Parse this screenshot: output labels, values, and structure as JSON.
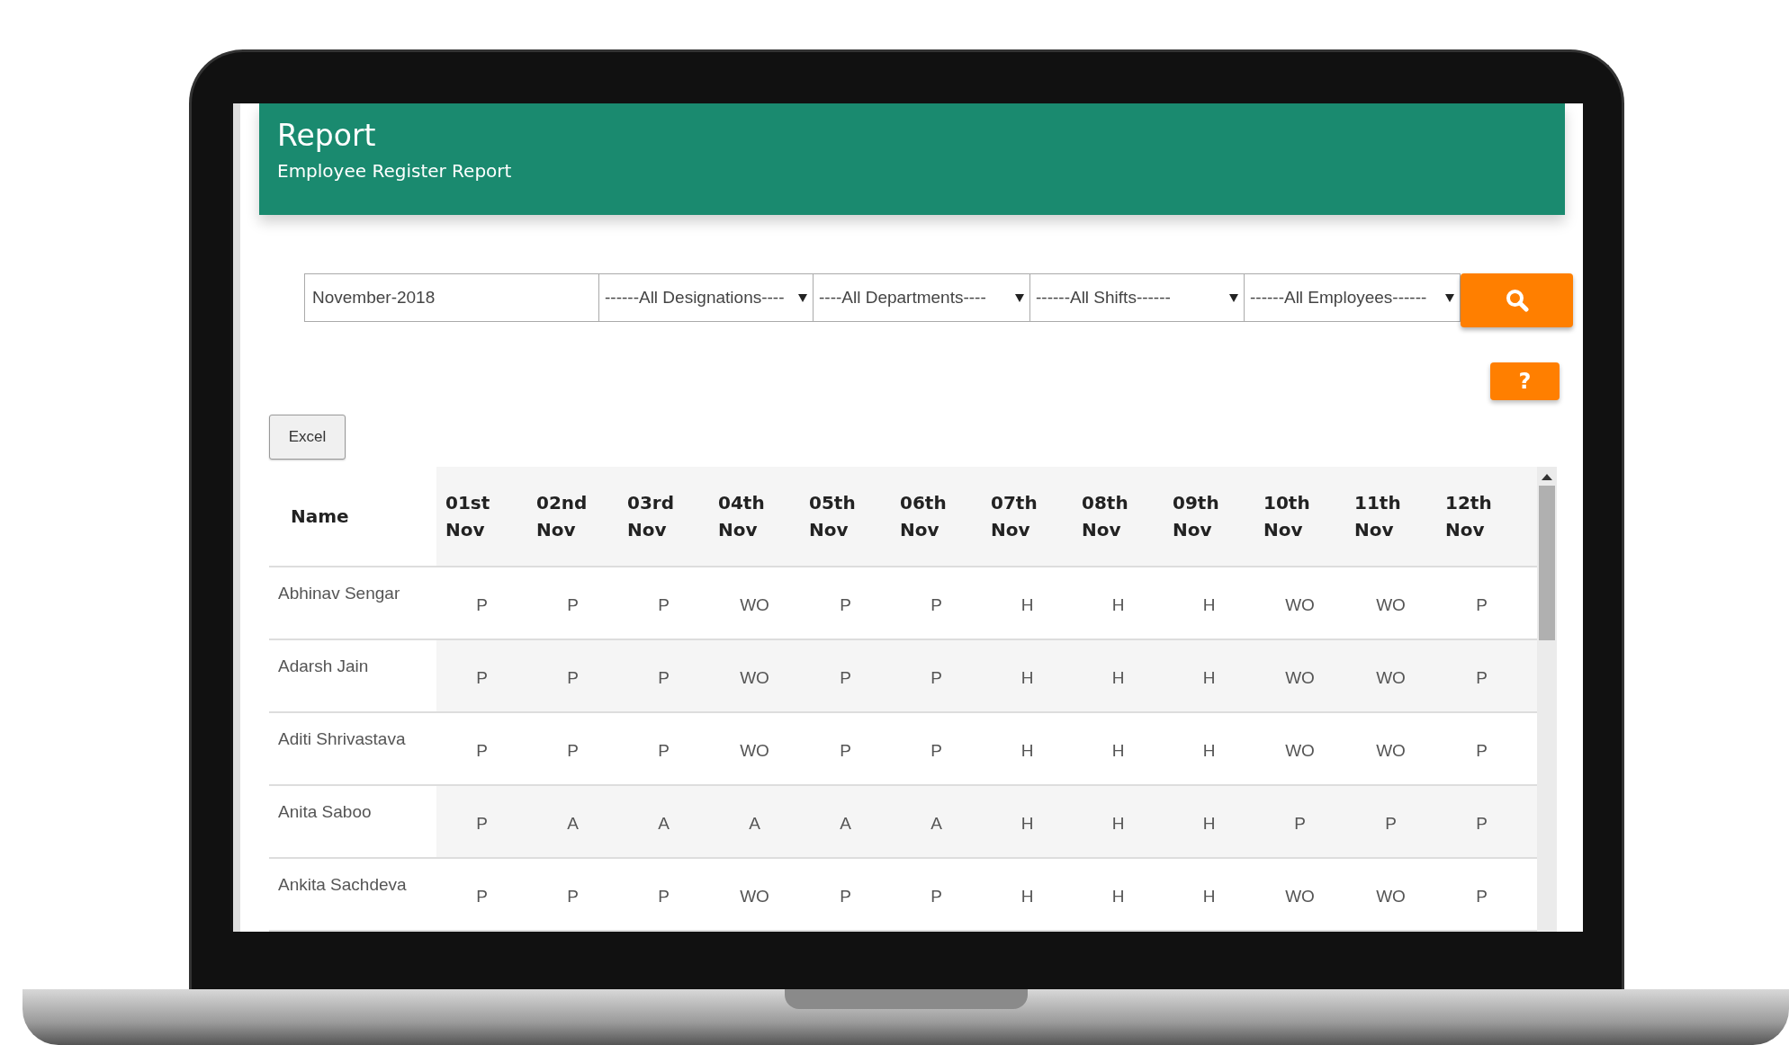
{
  "header": {
    "title": "Report",
    "subtitle": "Employee Register Report"
  },
  "filters": {
    "month": "November-2018",
    "selects": [
      "------All Designations----",
      "----All Departments----",
      "------All Shifts------",
      "------All Employees------"
    ]
  },
  "help_button": "?",
  "excel_button": "Excel",
  "table": {
    "columns": [
      "Name",
      "01st Nov",
      "02nd Nov",
      "03rd Nov",
      "04th Nov",
      "05th Nov",
      "06th Nov",
      "07th Nov",
      "08th Nov",
      "09th Nov",
      "10th Nov",
      "11th Nov",
      "12th Nov"
    ],
    "rows": [
      {
        "cells": [
          "Abhinav Sengar",
          "P",
          "P",
          "P",
          "WO",
          "P",
          "P",
          "H",
          "H",
          "H",
          "WO",
          "WO",
          "P"
        ]
      },
      {
        "cells": [
          "Adarsh Jain",
          "P",
          "P",
          "P",
          "WO",
          "P",
          "P",
          "H",
          "H",
          "H",
          "WO",
          "WO",
          "P"
        ]
      },
      {
        "cells": [
          "Aditi Shrivastava",
          "P",
          "P",
          "P",
          "WO",
          "P",
          "P",
          "H",
          "H",
          "H",
          "WO",
          "WO",
          "P"
        ]
      },
      {
        "cells": [
          "Anita Saboo",
          "P",
          "A",
          "A",
          "A",
          "A",
          "A",
          "H",
          "H",
          "H",
          "P",
          "P",
          "P"
        ]
      },
      {
        "cells": [
          "Ankita Sachdeva",
          "P",
          "P",
          "P",
          "WO",
          "P",
          "P",
          "H",
          "H",
          "H",
          "WO",
          "WO",
          "P"
        ]
      }
    ]
  }
}
